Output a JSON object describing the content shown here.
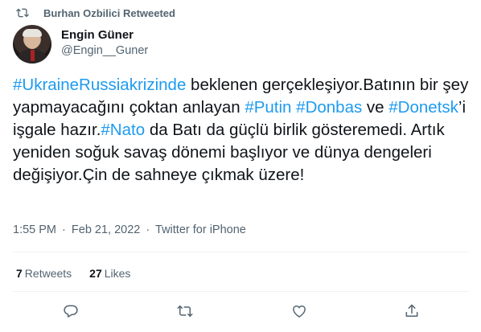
{
  "retweet_context": {
    "text": "Burhan Ozbilici Retweeted",
    "icon": "retweet-icon"
  },
  "author": {
    "name": "Engin Güner",
    "handle": "@Engin__Guner"
  },
  "tweet": {
    "segments": [
      {
        "text": "#UkraineRussiakrizinde",
        "hashtag": true
      },
      {
        "text": " beklenen gerçekleşiyor.Batının bir şey yapmayacağını çoktan anlayan ",
        "hashtag": false
      },
      {
        "text": "#Putin",
        "hashtag": true
      },
      {
        "text": " ",
        "hashtag": false
      },
      {
        "text": "#Donbas",
        "hashtag": true
      },
      {
        "text": " ve ",
        "hashtag": false
      },
      {
        "text": "#Donetsk",
        "hashtag": true
      },
      {
        "text": "’i işgale hazır.",
        "hashtag": false
      },
      {
        "text": "#Nato",
        "hashtag": true
      },
      {
        "text": " da Batı da güçlü birlik gösteremedi. Artık yeniden soğuk savaş dönemi başlıyor ve dünya dengeleri değişiyor.Çin de sahneye çıkmak üzere!",
        "hashtag": false
      }
    ],
    "time": "1:55 PM",
    "date": "Feb 21, 2022",
    "source": "Twitter for iPhone",
    "separator": "·"
  },
  "stats": {
    "retweets_count": "7",
    "retweets_label": "Retweets",
    "likes_count": "27",
    "likes_label": "Likes"
  },
  "colors": {
    "link": "#1d9bf0",
    "secondary_text": "#536471",
    "divider": "#eff3f4"
  },
  "actions": [
    "reply-icon",
    "retweet-icon",
    "like-icon",
    "share-icon"
  ]
}
